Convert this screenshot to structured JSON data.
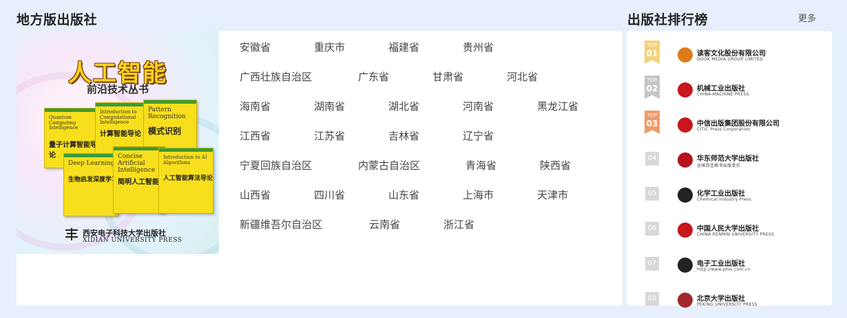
{
  "left_section": {
    "title": "地方版出版社",
    "banner": {
      "title": "人工智能",
      "subtitle": "前沿技术丛书",
      "books": [
        {
          "en": "Quantum Computing Intelligence",
          "cn": "量子计算智能导论"
        },
        {
          "en": "Introduction to Computational Intelligence",
          "cn": "计算智能导论"
        },
        {
          "en": "Pattern Recognition",
          "cn": "模式识别"
        },
        {
          "en": "Deep Learning",
          "cn": "生物启发深度学习"
        },
        {
          "en": "Concise Artificial Intelligence",
          "cn": "简明人工智能"
        },
        {
          "en": "Introduction to AI Algorithms",
          "cn": "人工智能算法导论"
        }
      ],
      "publisher_cn": "西安电子科技大学出版社",
      "publisher_en": "XIDIAN UNIVERSITY PRESS"
    },
    "provinces": [
      [
        "安徽省",
        "重庆市",
        "福建省",
        "贵州省"
      ],
      [
        "广西壮族自治区",
        "广东省",
        "甘肃省",
        "河北省"
      ],
      [
        "海南省",
        "湖南省",
        "湖北省",
        "河南省",
        "黑龙江省"
      ],
      [
        "江西省",
        "江苏省",
        "吉林省",
        "辽宁省"
      ],
      [
        "宁夏回族自治区",
        "内蒙古自治区",
        "青海省",
        "陕西省"
      ],
      [
        "山西省",
        "四川省",
        "山东省",
        "上海市",
        "天津市"
      ],
      [
        "新疆维吾尔自治区",
        "云南省",
        "浙江省"
      ]
    ]
  },
  "right_section": {
    "title": "出版社排行榜",
    "more": "更多",
    "ranks": [
      {
        "top": "TOP",
        "num": "01",
        "name": "读客文化股份有限公司",
        "en": "DOOK MEDIA GROUP LIMITED",
        "color": "#e07b1a"
      },
      {
        "top": "TOP",
        "num": "02",
        "name": "机械工业出版社",
        "en": "CHINA MACHINE PRESS",
        "color": "#c8161d"
      },
      {
        "top": "TOP",
        "num": "03",
        "name": "中信出版集团股份有限公司",
        "en": "CITIC Press Corporation",
        "color": "#c8161d"
      },
      {
        "num": "04",
        "name": "华东师范大学出版社",
        "en": "全国百佳图书出版单位",
        "color": "#b5121b"
      },
      {
        "num": "05",
        "name": "化学工业出版社",
        "en": "Chemical Industry Press",
        "color": "#222222"
      },
      {
        "num": "06",
        "name": "中国人民大学出版社",
        "en": "CHINA RENMIN UNIVERSITY PRESS",
        "color": "#c8161d"
      },
      {
        "num": "07",
        "name": "电子工业出版社",
        "en": "http://www.phei.com.cn",
        "color": "#222222"
      },
      {
        "num": "08",
        "name": "北京大学出版社",
        "en": "PEKING UNIVERSITY PRESS",
        "color": "#a3282c"
      }
    ]
  }
}
